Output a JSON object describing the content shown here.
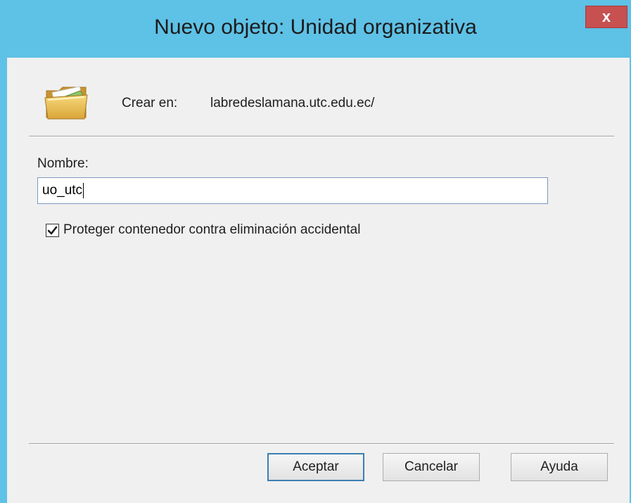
{
  "window": {
    "title": "Nuevo objeto: Unidad organizativa",
    "close_label": "x"
  },
  "create": {
    "label": "Crear en:",
    "value": "labredeslamana.utc.edu.ec/"
  },
  "name_field": {
    "label": "Nombre:",
    "value": "uo_utc"
  },
  "protect_checkbox": {
    "checked": true,
    "label": "Proteger contenedor contra eliminación accidental"
  },
  "buttons": {
    "ok": "Aceptar",
    "cancel": "Cancelar",
    "help": "Ayuda"
  },
  "colors": {
    "titlebar": "#5ec1e6",
    "close": "#c75050",
    "client": "#f0f0f0",
    "default_button_border": "#3c7fb1"
  },
  "icons": {
    "window_icon": "folder-icon",
    "close": "close-icon",
    "check": "checkmark-icon"
  }
}
